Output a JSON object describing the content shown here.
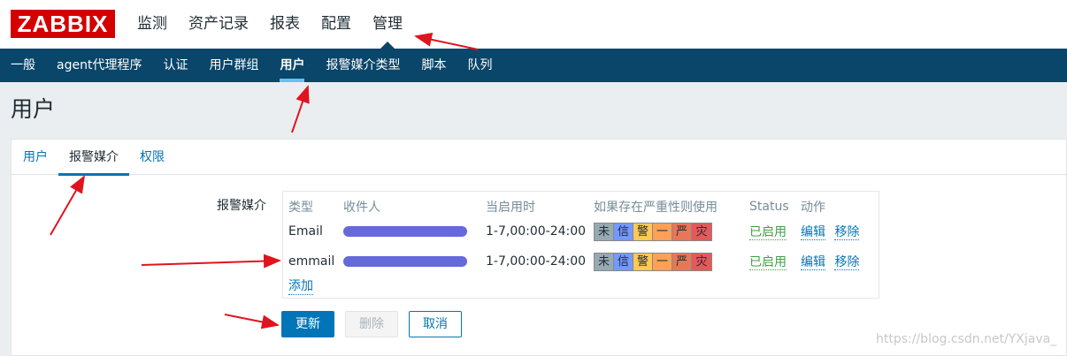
{
  "app": {
    "logo": "ZABBIX"
  },
  "main_nav": [
    "监测",
    "资产记录",
    "报表",
    "配置",
    "管理"
  ],
  "sub_nav": [
    "一般",
    "agent代理程序",
    "认证",
    "用户群组",
    "用户",
    "报警媒介类型",
    "脚本",
    "队列"
  ],
  "page_title": "用户",
  "tabs": [
    "用户",
    "报警媒介",
    "权限"
  ],
  "form": {
    "label": "报警媒介",
    "columns": [
      "类型",
      "收件人",
      "当启用时",
      "如果存在严重性则使用",
      "Status",
      "动作"
    ],
    "rows": [
      {
        "type": "Email",
        "when": "1-7,00:00-24:00",
        "status": "已启用",
        "edit": "编辑",
        "remove": "移除"
      },
      {
        "type": "emmail",
        "when": "1-7,00:00-24:00",
        "status": "已启用",
        "edit": "编辑",
        "remove": "移除"
      }
    ],
    "severity": [
      "未",
      "信",
      "警",
      "一",
      "严",
      "灾"
    ],
    "severity_colors": [
      "#97aab3",
      "#7499ff",
      "#ffc859",
      "#ffa059",
      "#e97659",
      "#e45959"
    ],
    "add_link": "添加"
  },
  "buttons": {
    "update": "更新",
    "delete": "删除",
    "cancel": "取消"
  },
  "watermark": "https://blog.csdn.net/YXjava_",
  "colors": {
    "header_bar": "#0a466a",
    "accent": "#0275b8",
    "logo": "#d40000",
    "annotation": "#e0141e"
  }
}
